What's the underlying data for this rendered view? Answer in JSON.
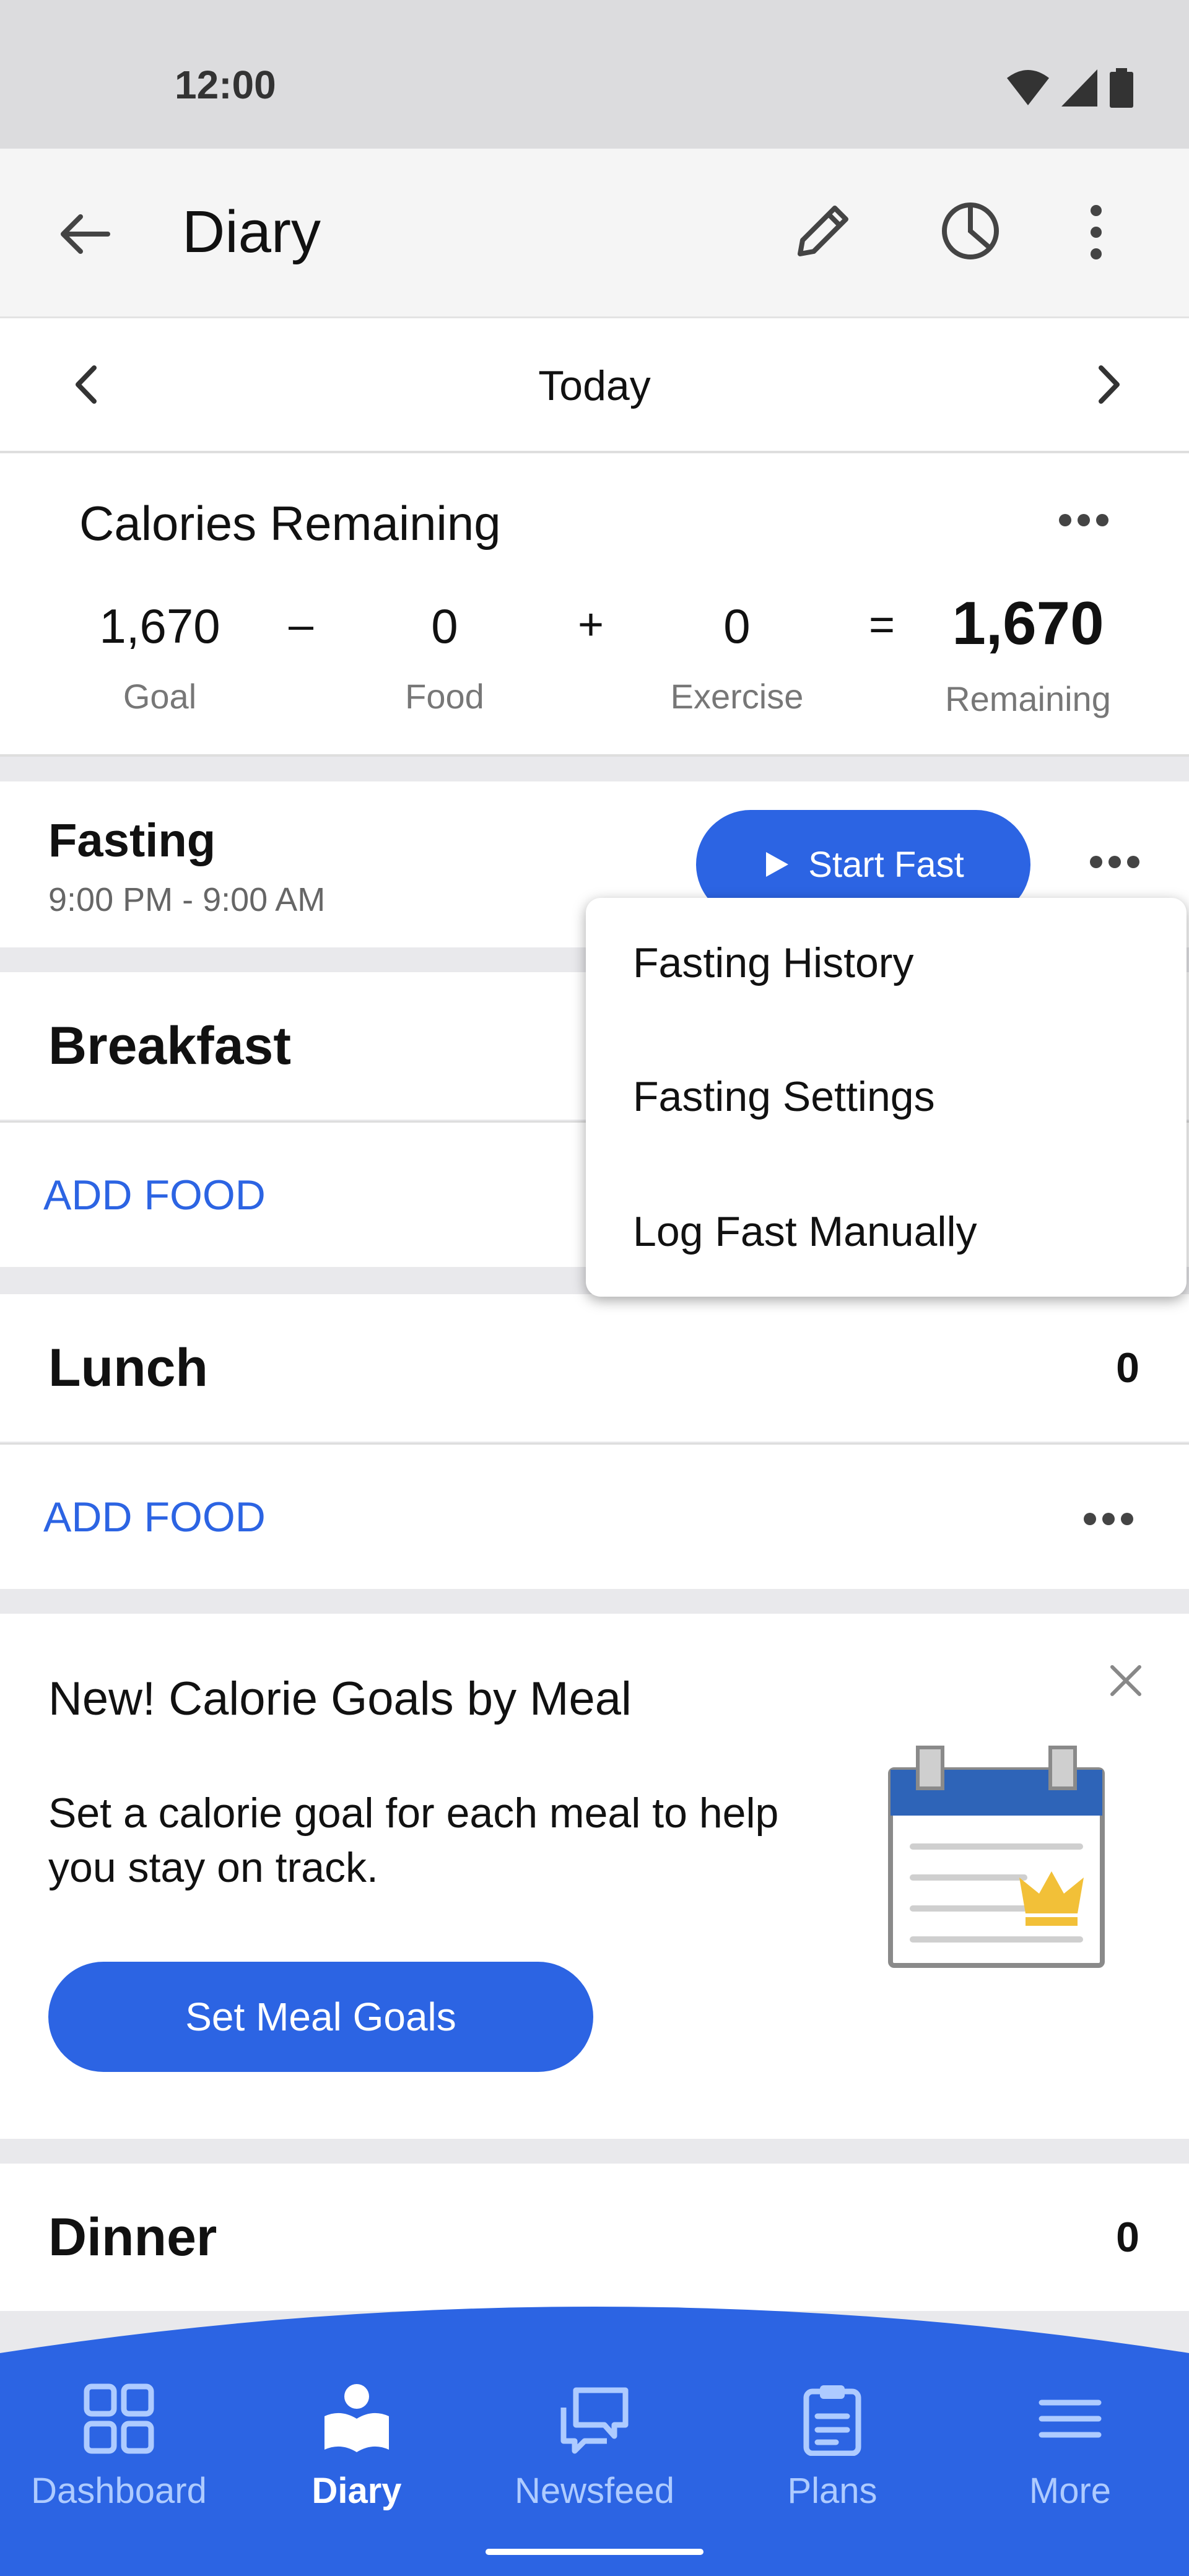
{
  "status_bar": {
    "time": "12:00"
  },
  "app_bar": {
    "title": "Diary"
  },
  "date_nav": {
    "label": "Today"
  },
  "calories": {
    "heading": "Calories Remaining",
    "goal_value": "1,670",
    "goal_label": "Goal",
    "op_minus": "–",
    "food_value": "0",
    "food_label": "Food",
    "op_plus": "+",
    "exercise_value": "0",
    "exercise_label": "Exercise",
    "op_equals": "=",
    "remaining_value": "1,670",
    "remaining_label": "Remaining"
  },
  "fasting": {
    "title": "Fasting",
    "time_range": "9:00 PM - 9:00 AM",
    "start_button": "Start Fast"
  },
  "fasting_menu": {
    "items": [
      {
        "label": "Fasting History"
      },
      {
        "label": "Fasting Settings"
      },
      {
        "label": "Log Fast Manually"
      }
    ]
  },
  "meals": {
    "breakfast": {
      "name": "Breakfast",
      "add_label": "ADD FOOD"
    },
    "lunch": {
      "name": "Lunch",
      "calories": "0",
      "add_label": "ADD FOOD"
    },
    "dinner": {
      "name": "Dinner",
      "calories": "0"
    }
  },
  "promo": {
    "title": "New! Calorie Goals by Meal",
    "body": "Set a calorie goal for each meal to help you stay on track.",
    "button": "Set Meal Goals"
  },
  "bottom_nav": {
    "items": [
      {
        "label": "Dashboard",
        "icon": "grid-icon"
      },
      {
        "label": "Diary",
        "icon": "diary-book-icon",
        "active": true
      },
      {
        "label": "Newsfeed",
        "icon": "chat-bubbles-icon"
      },
      {
        "label": "Plans",
        "icon": "clipboard-icon"
      },
      {
        "label": "More",
        "icon": "menu-icon"
      }
    ]
  },
  "colors": {
    "accent": "#2C64E3",
    "nav_inactive": "#AECBFF",
    "crown": "#F2C038"
  }
}
